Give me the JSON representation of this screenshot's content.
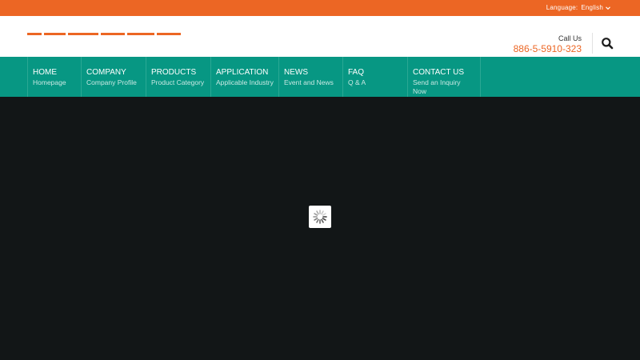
{
  "topbar": {
    "language_label": "Language:",
    "language_value": "English",
    "language_icon": "chevron-down-icon",
    "color": "#ec6624"
  },
  "header": {
    "logo_icon": "company-logo",
    "call_label": "Call Us",
    "phone": "886-5-5910-323",
    "search_icon": "search-icon"
  },
  "nav": {
    "color": "#079783",
    "items": [
      {
        "title": "HOME",
        "subtitle": "Homepage"
      },
      {
        "title": "COMPANY",
        "subtitle": "Company Profile"
      },
      {
        "title": "PRODUCTS",
        "subtitle": "Product Category"
      },
      {
        "title": "APPLICATION",
        "subtitle": "Applicable Industry"
      },
      {
        "title": "NEWS",
        "subtitle": "Event and News"
      },
      {
        "title": "FAQ",
        "subtitle": "Q & A"
      },
      {
        "title": "CONTACT US",
        "subtitle": "Send an Inquiry Now"
      }
    ]
  },
  "hero": {
    "background": "#121617",
    "loader_icon": "loading-spinner-icon"
  }
}
